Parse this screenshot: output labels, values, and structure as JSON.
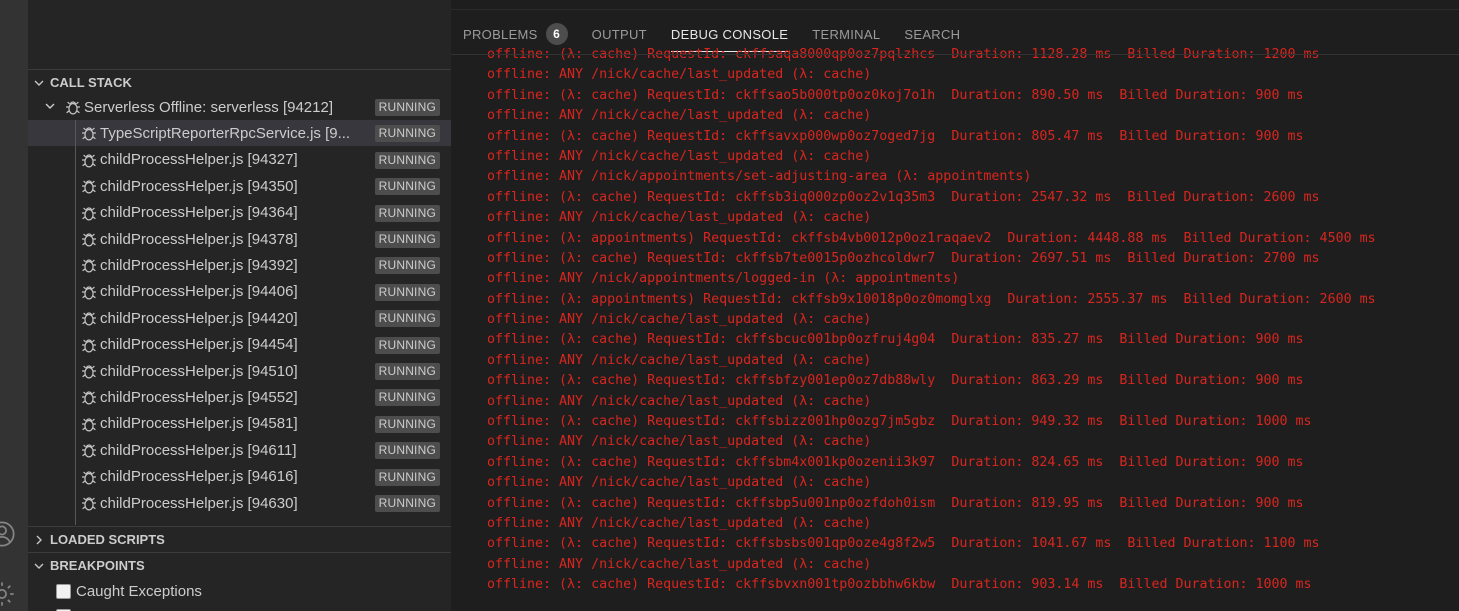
{
  "sidebar": {
    "call_stack_title": "CALL STACK",
    "session": {
      "label": "Serverless Offline: serverless [94212]",
      "status": "RUNNING"
    },
    "threads": [
      {
        "label": "TypeScriptReporterRpcService.js [9...",
        "status": "RUNNING",
        "selected": true
      },
      {
        "label": "childProcessHelper.js [94327]",
        "status": "RUNNING"
      },
      {
        "label": "childProcessHelper.js [94350]",
        "status": "RUNNING"
      },
      {
        "label": "childProcessHelper.js [94364]",
        "status": "RUNNING"
      },
      {
        "label": "childProcessHelper.js [94378]",
        "status": "RUNNING"
      },
      {
        "label": "childProcessHelper.js [94392]",
        "status": "RUNNING"
      },
      {
        "label": "childProcessHelper.js [94406]",
        "status": "RUNNING"
      },
      {
        "label": "childProcessHelper.js [94420]",
        "status": "RUNNING"
      },
      {
        "label": "childProcessHelper.js [94454]",
        "status": "RUNNING"
      },
      {
        "label": "childProcessHelper.js [94510]",
        "status": "RUNNING"
      },
      {
        "label": "childProcessHelper.js [94552]",
        "status": "RUNNING"
      },
      {
        "label": "childProcessHelper.js [94581]",
        "status": "RUNNING"
      },
      {
        "label": "childProcessHelper.js [94611]",
        "status": "RUNNING"
      },
      {
        "label": "childProcessHelper.js [94616]",
        "status": "RUNNING"
      },
      {
        "label": "childProcessHelper.js [94630]",
        "status": "RUNNING"
      }
    ],
    "loaded_scripts_title": "LOADED SCRIPTS",
    "breakpoints_title": "BREAKPOINTS",
    "breakpoints": [
      {
        "label": "Caught Exceptions",
        "checked": false
      }
    ]
  },
  "panel": {
    "tabs": [
      {
        "label": "PROBLEMS",
        "count": "6"
      },
      {
        "label": "OUTPUT"
      },
      {
        "label": "DEBUG CONSOLE",
        "active": true
      },
      {
        "label": "TERMINAL"
      },
      {
        "label": "SEARCH"
      }
    ],
    "console_lines": [
      "offline: (λ: cache) RequestId: ckffsaqa8000qp0oz7pqlzhcs  Duration: 1128.28 ms  Billed Duration: 1200 ms",
      "offline: ANY /nick/cache/last_updated (λ: cache)",
      "offline: (λ: cache) RequestId: ckffsao5b000tp0oz0koj7o1h  Duration: 890.50 ms  Billed Duration: 900 ms",
      "offline: ANY /nick/cache/last_updated (λ: cache)",
      "offline: (λ: cache) RequestId: ckffsavxp000wp0oz7oged7jg  Duration: 805.47 ms  Billed Duration: 900 ms",
      "offline: ANY /nick/cache/last_updated (λ: cache)",
      "offline: ANY /nick/appointments/set-adjusting-area (λ: appointments)",
      "offline: (λ: cache) RequestId: ckffsb3iq000zp0oz2v1q35m3  Duration: 2547.32 ms  Billed Duration: 2600 ms",
      "offline: ANY /nick/cache/last_updated (λ: cache)",
      "offline: (λ: appointments) RequestId: ckffsb4vb0012p0oz1raqaev2  Duration: 4448.88 ms  Billed Duration: 4500 ms",
      "offline: (λ: cache) RequestId: ckffsb7te0015p0ozhcoldwr7  Duration: 2697.51 ms  Billed Duration: 2700 ms",
      "offline: ANY /nick/appointments/logged-in (λ: appointments)",
      "offline: (λ: appointments) RequestId: ckffsb9x10018p0oz0momglxg  Duration: 2555.37 ms  Billed Duration: 2600 ms",
      "offline: ANY /nick/cache/last_updated (λ: cache)",
      "offline: (λ: cache) RequestId: ckffsbcuc001bp0ozfruj4g04  Duration: 835.27 ms  Billed Duration: 900 ms",
      "offline: ANY /nick/cache/last_updated (λ: cache)",
      "offline: (λ: cache) RequestId: ckffsbfzy001ep0oz7db88wly  Duration: 863.29 ms  Billed Duration: 900 ms",
      "offline: ANY /nick/cache/last_updated (λ: cache)",
      "offline: (λ: cache) RequestId: ckffsbizz001hp0ozg7jm5gbz  Duration: 949.32 ms  Billed Duration: 1000 ms",
      "offline: ANY /nick/cache/last_updated (λ: cache)",
      "offline: (λ: cache) RequestId: ckffsbm4x001kp0ozenii3k97  Duration: 824.65 ms  Billed Duration: 900 ms",
      "offline: ANY /nick/cache/last_updated (λ: cache)",
      "offline: (λ: cache) RequestId: ckffsbp5u001np0ozfdoh0ism  Duration: 819.95 ms  Billed Duration: 900 ms",
      "offline: ANY /nick/cache/last_updated (λ: cache)",
      "offline: (λ: cache) RequestId: ckffsbsbs001qp0oze4g8f2w5  Duration: 1041.67 ms  Billed Duration: 1100 ms",
      "offline: ANY /nick/cache/last_updated (λ: cache)",
      "offline: (λ: cache) RequestId: ckffsbvxn001tp0ozbbhw6kbw  Duration: 903.14 ms  Billed Duration: 1000 ms"
    ]
  },
  "icons": {
    "account": "account-icon",
    "settings": "gear-icon",
    "thread": "bug-icon"
  },
  "colors": {
    "console_text": "#d8261f",
    "badge_bg": "#4d4d4d",
    "sidebar_bg": "#252526",
    "panel_bg": "#1e1e1e"
  }
}
